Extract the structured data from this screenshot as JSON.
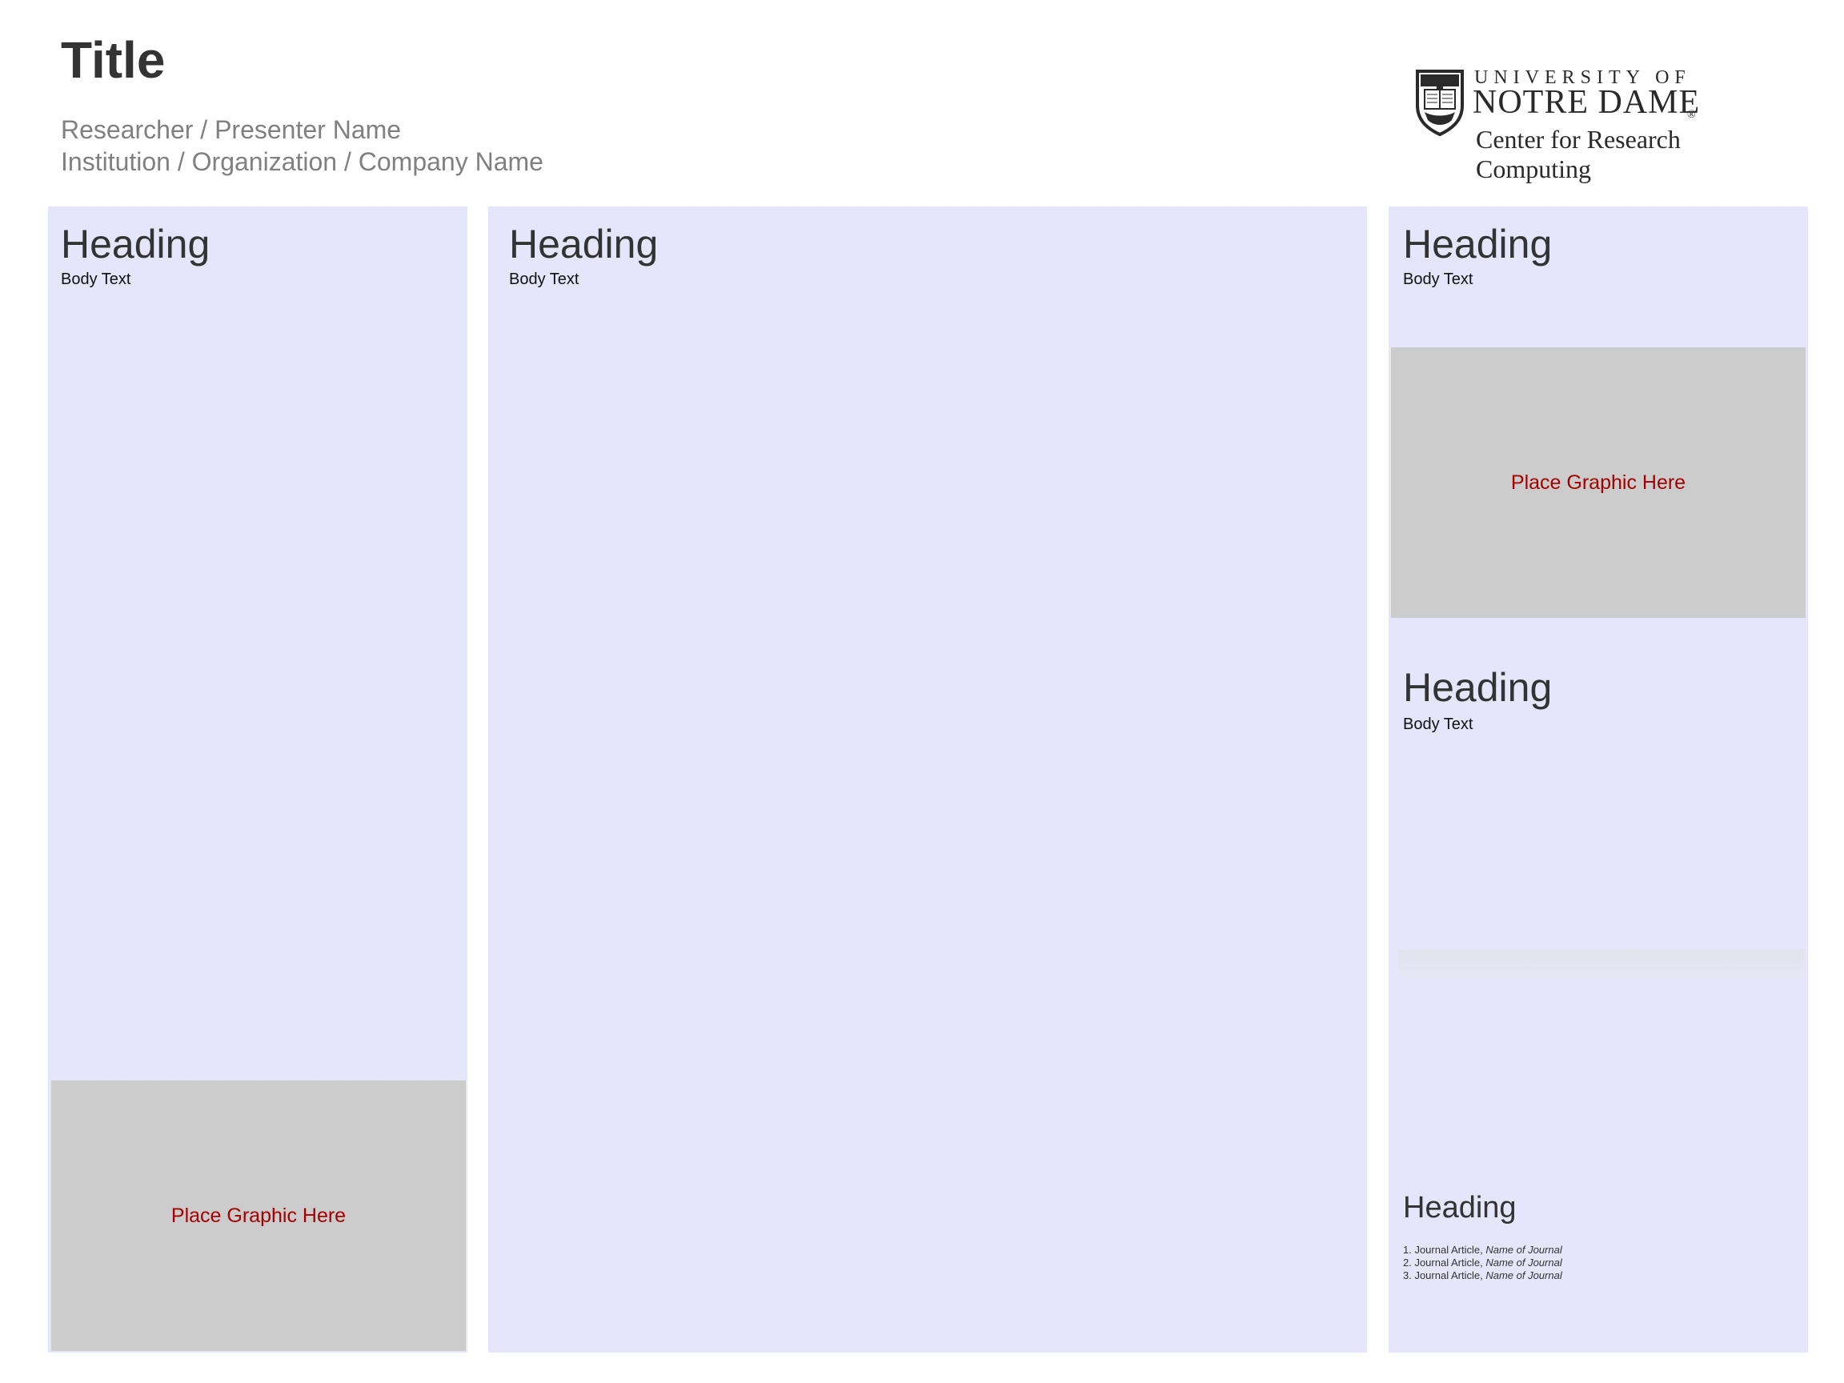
{
  "header": {
    "title": "Title",
    "presenter": "Researcher / Presenter Name",
    "institution": "Institution / Organization  / Company Name"
  },
  "logo": {
    "line1": "UNIVERSITY OF",
    "line2": "NOTRE DAME",
    "registered": "®",
    "line3": "Center for Research Computing"
  },
  "left_column": {
    "heading": "Heading",
    "body": "Body Text",
    "graphic_placeholder": "Place Graphic Here"
  },
  "middle_column": {
    "heading": "Heading",
    "body": "Body Text"
  },
  "right_column": {
    "section1": {
      "heading": "Heading",
      "body": "Body Text",
      "graphic_placeholder": "Place Graphic Here"
    },
    "section2": {
      "heading": "Heading",
      "body": "Body Text"
    },
    "references": {
      "heading": "Heading",
      "items": [
        {
          "prefix": "1. Journal Article, ",
          "journal": "Name of Journal"
        },
        {
          "prefix": "2. Journal Article, ",
          "journal": "Name of Journal"
        },
        {
          "prefix": "3. Journal Article, ",
          "journal": "Name of Journal"
        }
      ]
    }
  },
  "colors": {
    "panel_background": "#e5e5fb",
    "graphic_background": "#cccccc",
    "placeholder_text": "#a50000",
    "heading_text": "#333333",
    "subtitle_text": "#808080"
  }
}
